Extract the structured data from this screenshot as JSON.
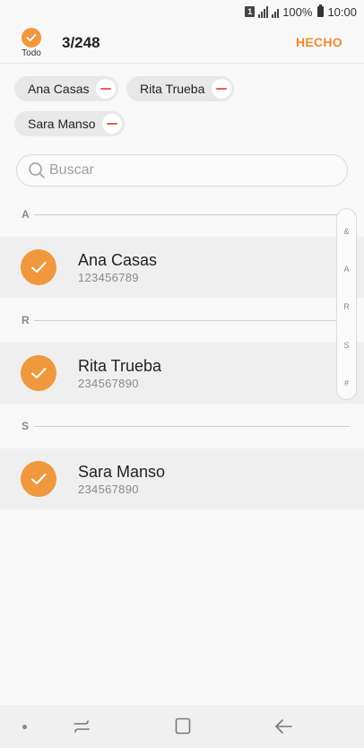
{
  "status_bar": {
    "sim_label": "1",
    "battery_text": "100%",
    "time": "10:00"
  },
  "header": {
    "select_all_label": "Todo",
    "count": "3/248",
    "done_label": "HECHO"
  },
  "chips": [
    {
      "name": "Ana Casas"
    },
    {
      "name": "Rita Trueba"
    },
    {
      "name": "Sara Manso"
    }
  ],
  "search": {
    "placeholder": "Buscar"
  },
  "sections": [
    {
      "letter": "A",
      "contact": {
        "name": "Ana Casas",
        "number": "123456789"
      }
    },
    {
      "letter": "R",
      "contact": {
        "name": "Rita Trueba",
        "number": "234567890"
      }
    },
    {
      "letter": "S",
      "contact": {
        "name": "Sara Manso",
        "number": "234567890"
      }
    }
  ],
  "index_scroller": [
    "&",
    "A",
    "R",
    "S",
    "#"
  ],
  "colors": {
    "accent": "#f0983e",
    "done_text": "#ef8a2b",
    "remove_icon": "#e5614d"
  },
  "icons": {
    "check": "check-icon",
    "search": "search-icon",
    "remove": "minus-icon",
    "recents": "recents-icon",
    "home": "home-icon",
    "back": "back-icon"
  }
}
